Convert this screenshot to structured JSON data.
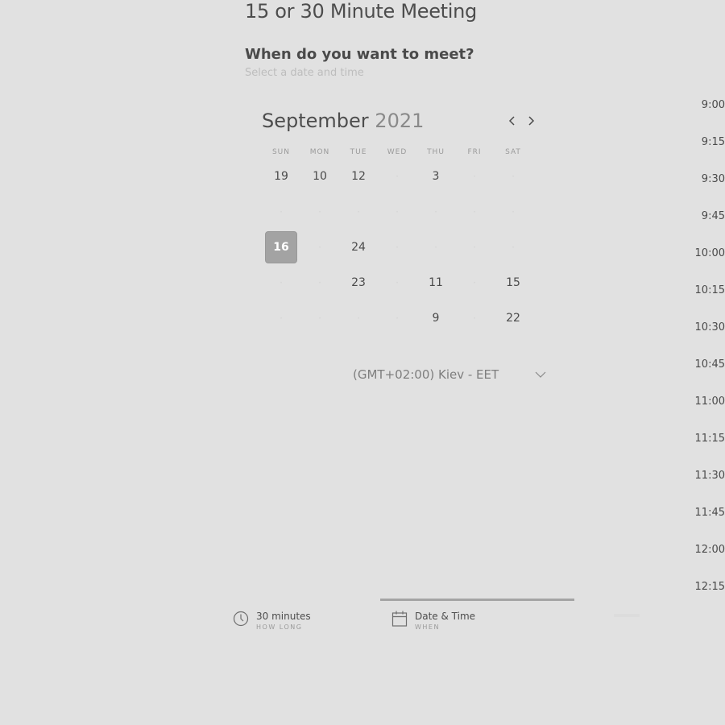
{
  "header": {
    "title": "15 or 30 Minute Meeting",
    "question": "When do you want to meet?",
    "subquestion": "Select a date and time"
  },
  "calendar": {
    "month": "September",
    "year": "2021",
    "prev_label": "previous month",
    "next_label": "next month",
    "weekdays": [
      "SUN",
      "MON",
      "TUE",
      "WED",
      "THU",
      "FRI",
      "SAT"
    ],
    "weeks": [
      [
        "19",
        "10",
        "12",
        "",
        "3",
        "",
        ""
      ],
      [
        "",
        "",
        "",
        "",
        "",
        "",
        ""
      ],
      [
        "16",
        "",
        "24",
        "",
        "",
        "",
        ""
      ],
      [
        "",
        "",
        "23",
        "",
        "11",
        "",
        "15"
      ],
      [
        "",
        "",
        "",
        "",
        "9",
        "",
        "22"
      ]
    ],
    "selected": "16"
  },
  "timezone": {
    "label": "(GMT+02:00) Kiev - EET"
  },
  "times": [
    "9:00",
    "9:15",
    "9:30",
    "9:45",
    "10:00",
    "10:15",
    "10:30",
    "10:45",
    "11:00",
    "11:15",
    "11:30",
    "11:45",
    "12:00",
    "12:15"
  ],
  "steps": [
    {
      "label": "30 minutes",
      "sub": "HOW LONG",
      "icon": "clock-icon"
    },
    {
      "label": "Date & Time",
      "sub": "WHEN",
      "icon": "calendar-icon"
    }
  ]
}
